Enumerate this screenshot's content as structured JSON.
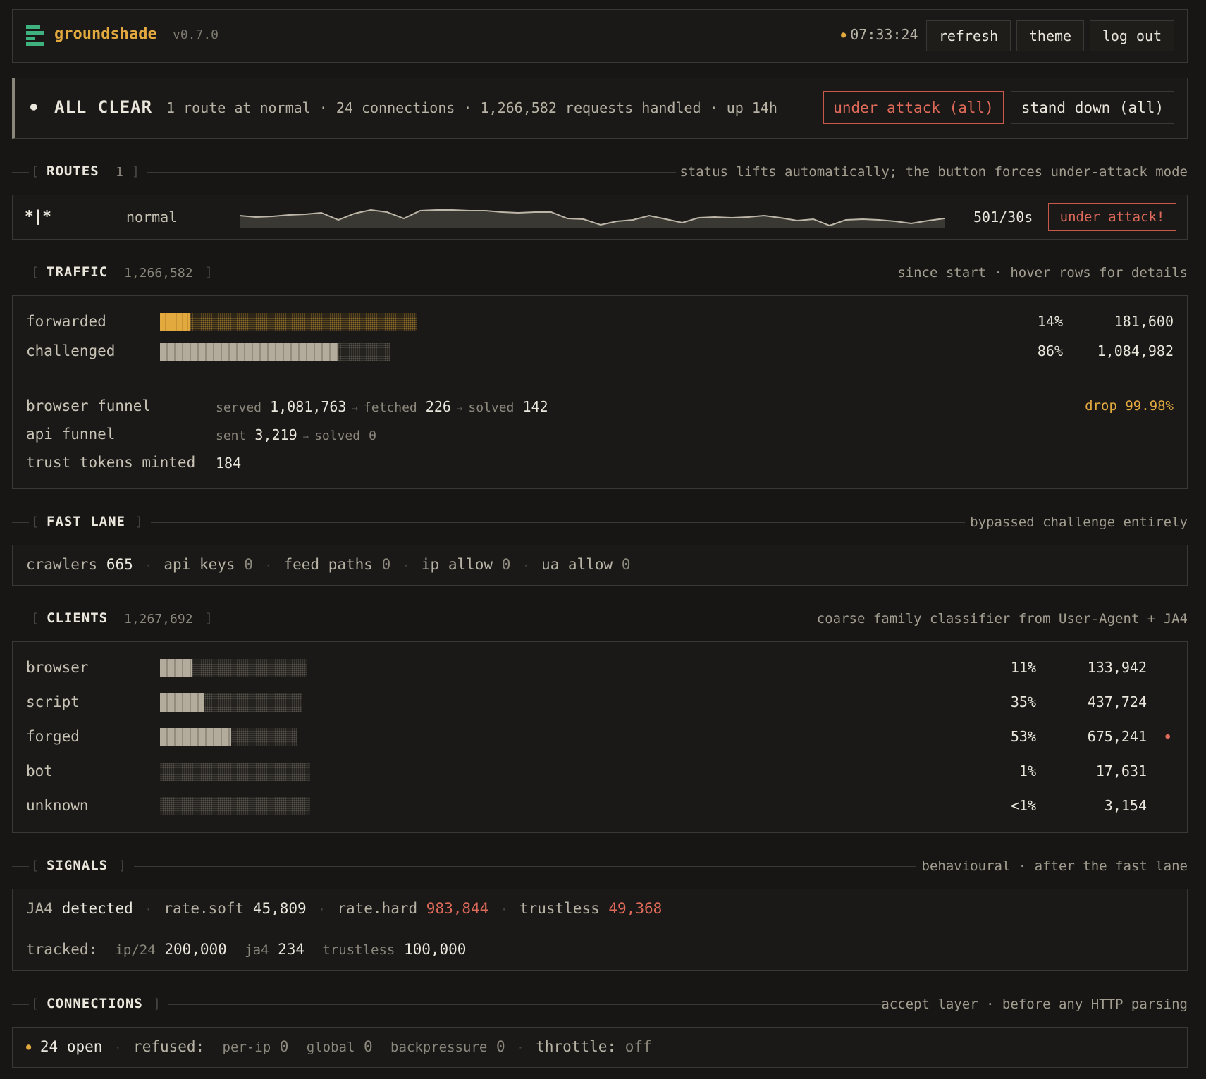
{
  "header": {
    "app_name": "groundshade",
    "version": "v0.7.0",
    "clock": "07:33:24",
    "buttons": {
      "refresh": "refresh",
      "theme": "theme",
      "logout": "log out"
    }
  },
  "status": {
    "title": "ALL CLEAR",
    "summary": "1 route at normal · 24 connections · 1,266,582 requests handled · up 14h",
    "attack_all": "under attack (all)",
    "stand_down_all": "stand down (all)"
  },
  "routes": {
    "title": "ROUTES",
    "count": "1",
    "note": "status lifts automatically; the button forces under-attack mode",
    "items": [
      {
        "pattern": "*|*",
        "status": "normal",
        "rate": "501/30s",
        "action": "under attack!",
        "spark": [
          12,
          14,
          13,
          11,
          10,
          8,
          18,
          9,
          5,
          7,
          16,
          6,
          5,
          5,
          6,
          6,
          7,
          8,
          7,
          7,
          16,
          17,
          24,
          20,
          18,
          12,
          17,
          21,
          15,
          14,
          15,
          14,
          12,
          15,
          19,
          17,
          25,
          18,
          17,
          18,
          20,
          22,
          19,
          16
        ]
      }
    ]
  },
  "traffic": {
    "title": "TRAFFIC",
    "count": "1,266,582",
    "note": "since start · hover rows for details",
    "rows": [
      {
        "label": "forwarded",
        "pct": "14%",
        "value": "181,600",
        "fraction": 0.14
      },
      {
        "label": "challenged",
        "pct": "86%",
        "value": "1,084,982",
        "fraction": 0.86
      }
    ],
    "browser_funnel": {
      "label": "browser funnel",
      "served_label": "served",
      "served": "1,081,763",
      "fetched_label": "fetched",
      "fetched": "226",
      "solved_label": "solved",
      "solved": "142",
      "drop": "drop 99.98%"
    },
    "api_funnel": {
      "label": "api funnel",
      "sent_label": "sent",
      "sent": "3,219",
      "solved_label": "solved",
      "solved": "0"
    },
    "trust_tokens": {
      "label": "trust tokens minted",
      "value": "184"
    }
  },
  "fast_lane": {
    "title": "FAST LANE",
    "note": "bypassed challenge entirely",
    "items": [
      {
        "label": "crawlers",
        "value": "665"
      },
      {
        "label": "api keys",
        "value": "0"
      },
      {
        "label": "feed paths",
        "value": "0"
      },
      {
        "label": "ip allow",
        "value": "0"
      },
      {
        "label": "ua allow",
        "value": "0"
      }
    ]
  },
  "clients": {
    "title": "CLIENTS",
    "count": "1,267,692",
    "note": "coarse family classifier from User-Agent + JA4",
    "rows": [
      {
        "label": "browser",
        "pct": "11%",
        "value": "133,942",
        "fraction": 0.11
      },
      {
        "label": "script",
        "pct": "35%",
        "value": "437,724",
        "fraction": 0.35
      },
      {
        "label": "forged",
        "pct": "53%",
        "value": "675,241",
        "fraction": 0.53,
        "flag": "●"
      },
      {
        "label": "bot",
        "pct": "1%",
        "value": "17,631",
        "fraction": 0.01
      },
      {
        "label": "unknown",
        "pct": "<1%",
        "value": "3,154",
        "fraction": 0.0025
      }
    ]
  },
  "signals": {
    "title": "SIGNALS",
    "note": "behavioural · after the fast lane",
    "ja4_label": "JA4",
    "ja4_value": "detected",
    "rate_soft_label": "rate.soft",
    "rate_soft": "45,809",
    "rate_hard_label": "rate.hard",
    "rate_hard": "983,844",
    "trustless_label": "trustless",
    "trustless": "49,368",
    "tracked_label": "tracked:",
    "ip24_label": "ip/24",
    "ip24": "200,000",
    "ja4t_label": "ja4",
    "ja4t": "234",
    "trustless_t_label": "trustless",
    "trustless_t": "100,000"
  },
  "connections": {
    "title": "CONNECTIONS",
    "note": "accept layer · before any HTTP parsing",
    "open": "24 open",
    "refused_label": "refused:",
    "per_ip_label": "per-ip",
    "per_ip": "0",
    "global_label": "global",
    "global": "0",
    "backpressure_label": "backpressure",
    "backpressure": "0",
    "throttle_label": "throttle:",
    "throttle": "off"
  },
  "colors": {
    "accent": "#e2a93f",
    "danger": "#e06a5a",
    "logo": "#3fb37f"
  }
}
